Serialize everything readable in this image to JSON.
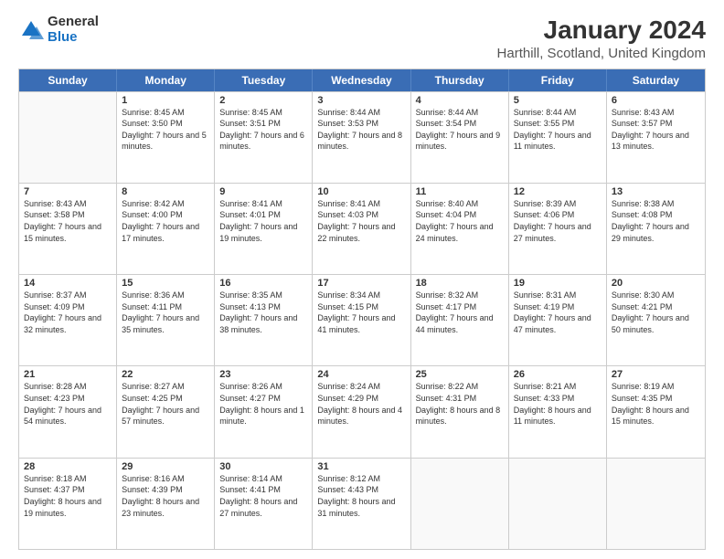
{
  "logo": {
    "general": "General",
    "blue": "Blue"
  },
  "title": "January 2024",
  "subtitle": "Harthill, Scotland, United Kingdom",
  "days_of_week": [
    "Sunday",
    "Monday",
    "Tuesday",
    "Wednesday",
    "Thursday",
    "Friday",
    "Saturday"
  ],
  "weeks": [
    [
      {
        "day": "",
        "sunrise": "",
        "sunset": "",
        "daylight": "",
        "empty": true
      },
      {
        "day": "1",
        "sunrise": "Sunrise: 8:45 AM",
        "sunset": "Sunset: 3:50 PM",
        "daylight": "Daylight: 7 hours and 5 minutes."
      },
      {
        "day": "2",
        "sunrise": "Sunrise: 8:45 AM",
        "sunset": "Sunset: 3:51 PM",
        "daylight": "Daylight: 7 hours and 6 minutes."
      },
      {
        "day": "3",
        "sunrise": "Sunrise: 8:44 AM",
        "sunset": "Sunset: 3:53 PM",
        "daylight": "Daylight: 7 hours and 8 minutes."
      },
      {
        "day": "4",
        "sunrise": "Sunrise: 8:44 AM",
        "sunset": "Sunset: 3:54 PM",
        "daylight": "Daylight: 7 hours and 9 minutes."
      },
      {
        "day": "5",
        "sunrise": "Sunrise: 8:44 AM",
        "sunset": "Sunset: 3:55 PM",
        "daylight": "Daylight: 7 hours and 11 minutes."
      },
      {
        "day": "6",
        "sunrise": "Sunrise: 8:43 AM",
        "sunset": "Sunset: 3:57 PM",
        "daylight": "Daylight: 7 hours and 13 minutes."
      }
    ],
    [
      {
        "day": "7",
        "sunrise": "Sunrise: 8:43 AM",
        "sunset": "Sunset: 3:58 PM",
        "daylight": "Daylight: 7 hours and 15 minutes."
      },
      {
        "day": "8",
        "sunrise": "Sunrise: 8:42 AM",
        "sunset": "Sunset: 4:00 PM",
        "daylight": "Daylight: 7 hours and 17 minutes."
      },
      {
        "day": "9",
        "sunrise": "Sunrise: 8:41 AM",
        "sunset": "Sunset: 4:01 PM",
        "daylight": "Daylight: 7 hours and 19 minutes."
      },
      {
        "day": "10",
        "sunrise": "Sunrise: 8:41 AM",
        "sunset": "Sunset: 4:03 PM",
        "daylight": "Daylight: 7 hours and 22 minutes."
      },
      {
        "day": "11",
        "sunrise": "Sunrise: 8:40 AM",
        "sunset": "Sunset: 4:04 PM",
        "daylight": "Daylight: 7 hours and 24 minutes."
      },
      {
        "day": "12",
        "sunrise": "Sunrise: 8:39 AM",
        "sunset": "Sunset: 4:06 PM",
        "daylight": "Daylight: 7 hours and 27 minutes."
      },
      {
        "day": "13",
        "sunrise": "Sunrise: 8:38 AM",
        "sunset": "Sunset: 4:08 PM",
        "daylight": "Daylight: 7 hours and 29 minutes."
      }
    ],
    [
      {
        "day": "14",
        "sunrise": "Sunrise: 8:37 AM",
        "sunset": "Sunset: 4:09 PM",
        "daylight": "Daylight: 7 hours and 32 minutes."
      },
      {
        "day": "15",
        "sunrise": "Sunrise: 8:36 AM",
        "sunset": "Sunset: 4:11 PM",
        "daylight": "Daylight: 7 hours and 35 minutes."
      },
      {
        "day": "16",
        "sunrise": "Sunrise: 8:35 AM",
        "sunset": "Sunset: 4:13 PM",
        "daylight": "Daylight: 7 hours and 38 minutes."
      },
      {
        "day": "17",
        "sunrise": "Sunrise: 8:34 AM",
        "sunset": "Sunset: 4:15 PM",
        "daylight": "Daylight: 7 hours and 41 minutes."
      },
      {
        "day": "18",
        "sunrise": "Sunrise: 8:32 AM",
        "sunset": "Sunset: 4:17 PM",
        "daylight": "Daylight: 7 hours and 44 minutes."
      },
      {
        "day": "19",
        "sunrise": "Sunrise: 8:31 AM",
        "sunset": "Sunset: 4:19 PM",
        "daylight": "Daylight: 7 hours and 47 minutes."
      },
      {
        "day": "20",
        "sunrise": "Sunrise: 8:30 AM",
        "sunset": "Sunset: 4:21 PM",
        "daylight": "Daylight: 7 hours and 50 minutes."
      }
    ],
    [
      {
        "day": "21",
        "sunrise": "Sunrise: 8:28 AM",
        "sunset": "Sunset: 4:23 PM",
        "daylight": "Daylight: 7 hours and 54 minutes."
      },
      {
        "day": "22",
        "sunrise": "Sunrise: 8:27 AM",
        "sunset": "Sunset: 4:25 PM",
        "daylight": "Daylight: 7 hours and 57 minutes."
      },
      {
        "day": "23",
        "sunrise": "Sunrise: 8:26 AM",
        "sunset": "Sunset: 4:27 PM",
        "daylight": "Daylight: 8 hours and 1 minute."
      },
      {
        "day": "24",
        "sunrise": "Sunrise: 8:24 AM",
        "sunset": "Sunset: 4:29 PM",
        "daylight": "Daylight: 8 hours and 4 minutes."
      },
      {
        "day": "25",
        "sunrise": "Sunrise: 8:22 AM",
        "sunset": "Sunset: 4:31 PM",
        "daylight": "Daylight: 8 hours and 8 minutes."
      },
      {
        "day": "26",
        "sunrise": "Sunrise: 8:21 AM",
        "sunset": "Sunset: 4:33 PM",
        "daylight": "Daylight: 8 hours and 11 minutes."
      },
      {
        "day": "27",
        "sunrise": "Sunrise: 8:19 AM",
        "sunset": "Sunset: 4:35 PM",
        "daylight": "Daylight: 8 hours and 15 minutes."
      }
    ],
    [
      {
        "day": "28",
        "sunrise": "Sunrise: 8:18 AM",
        "sunset": "Sunset: 4:37 PM",
        "daylight": "Daylight: 8 hours and 19 minutes."
      },
      {
        "day": "29",
        "sunrise": "Sunrise: 8:16 AM",
        "sunset": "Sunset: 4:39 PM",
        "daylight": "Daylight: 8 hours and 23 minutes."
      },
      {
        "day": "30",
        "sunrise": "Sunrise: 8:14 AM",
        "sunset": "Sunset: 4:41 PM",
        "daylight": "Daylight: 8 hours and 27 minutes."
      },
      {
        "day": "31",
        "sunrise": "Sunrise: 8:12 AM",
        "sunset": "Sunset: 4:43 PM",
        "daylight": "Daylight: 8 hours and 31 minutes."
      },
      {
        "day": "",
        "sunrise": "",
        "sunset": "",
        "daylight": "",
        "empty": true
      },
      {
        "day": "",
        "sunrise": "",
        "sunset": "",
        "daylight": "",
        "empty": true
      },
      {
        "day": "",
        "sunrise": "",
        "sunset": "",
        "daylight": "",
        "empty": true
      }
    ]
  ]
}
